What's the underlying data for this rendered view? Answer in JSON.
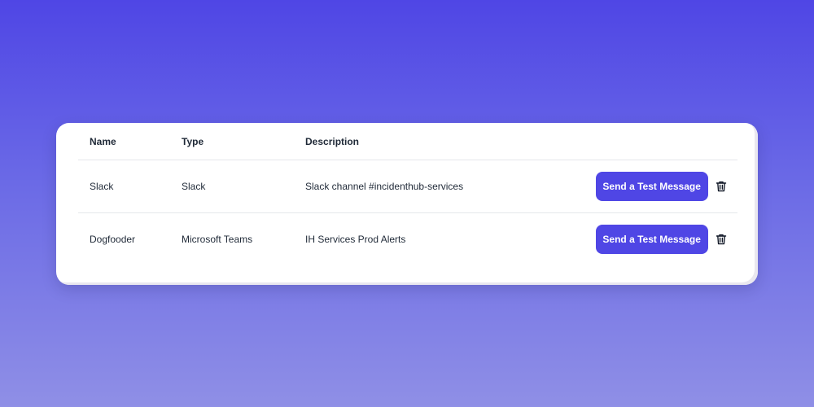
{
  "table": {
    "headers": {
      "name": "Name",
      "type": "Type",
      "description": "Description"
    },
    "rows": [
      {
        "name": "Slack",
        "type": "Slack",
        "description": "Slack channel #incidenthub-services",
        "action_label": "Send a Test Message",
        "delete_icon": "trash-icon"
      },
      {
        "name": "Dogfooder",
        "type": "Microsoft Teams",
        "description": "IH Services Prod Alerts",
        "action_label": "Send a Test Message",
        "delete_icon": "trash-icon"
      }
    ]
  },
  "colors": {
    "accent": "#4f46e5",
    "background_top": "#4f46e5",
    "background_bottom": "#8f8fe6",
    "card": "#ffffff",
    "text": "#1f2937"
  }
}
